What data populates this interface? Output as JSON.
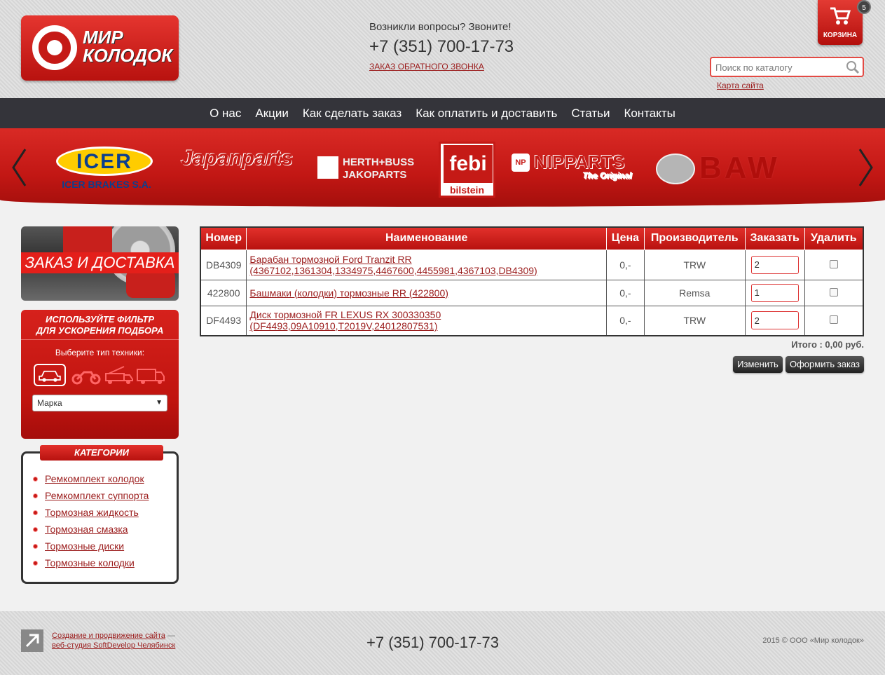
{
  "header": {
    "logo_text_line1": "МИР",
    "logo_text_line2": "КОЛОДОК",
    "questions": "Возникли вопросы? Звоните!",
    "phone": "+7 (351) 700-17-73",
    "callback": "ЗАКАЗ ОБРАТНОГО ЗВОНКА",
    "cart_label": "КОРЗИНА",
    "cart_count": "5",
    "search_placeholder": "Поиск по каталогу",
    "sitemap": "Карта сайта"
  },
  "nav": {
    "items": [
      "О нас",
      "Акции",
      "Как сделать заказ",
      "Как оплатить и доставить",
      "Статьи",
      "Контакты"
    ]
  },
  "brands": {
    "icer": "ICER",
    "icer_sub": "ICER BRAKES S.A.",
    "japanparts": "Japanparts",
    "herth_line1": "HERTH+BUSS",
    "herth_line2": "JAKOPARTS",
    "febi": "febi",
    "febi_sub": "bilstein",
    "nipparts_np": "NP",
    "nipparts": "NIPPARTS",
    "nipparts_sub": "The Original",
    "baw": "BAW"
  },
  "sidebar": {
    "order_banner": "ЗАКАЗ И ДОСТАВКА",
    "filter_title_line1": "ИСПОЛЬЗУЙТЕ ФИЛЬТР",
    "filter_title_line2": "ДЛЯ УСКОРЕНИЯ ПОДБОРА",
    "filter_sub": "Выберите тип техники:",
    "brand_select_value": "Марка",
    "categories_title": "КАТЕГОРИИ",
    "categories": [
      "Ремкомплект колодок",
      "Ремкомплект суппорта",
      "Тормозная жидкость",
      "Тормозная смазка",
      "Тормозные диски",
      "Тормозные колодки"
    ]
  },
  "order": {
    "columns": [
      "Номер",
      "Наименование",
      "Цена",
      "Производитель",
      "Заказать",
      "Удалить"
    ],
    "rows": [
      {
        "number": "DB4309",
        "name_line1": "Барабан тормозной Ford Tranzit RR",
        "name_line2": "(4367102,1361304,1334975,4467600,4455981,4367103,DB4309)",
        "price": "0,-",
        "maker": "TRW",
        "qty": "2"
      },
      {
        "number": "422800",
        "name_line1": "Башмаки (колодки) тормозные RR (422800)",
        "name_line2": "",
        "price": "0,-",
        "maker": "Remsa",
        "qty": "1"
      },
      {
        "number": "DF4493",
        "name_line1": "Диск тормозной FR LEXUS RX 300330350",
        "name_line2": "(DF4493,09A10910,T2019V,24012807531)",
        "price": "0,-",
        "maker": "TRW",
        "qty": "2"
      }
    ],
    "total": "Итого : 0,00 руб.",
    "change_button": "Изменить",
    "checkout_button": "Оформить заказ"
  },
  "footer": {
    "dev_link": "Создание и продвижение сайта",
    "dev_dash": " —",
    "dev_studio": "веб-студия SoftDevelop Челябинск",
    "phone": "+7 (351) 700-17-73",
    "copyright": "2015 © ООО «Мир колодок»"
  },
  "colors": {
    "brand_red": "#c51a16",
    "nav_bg": "#34343a",
    "link_red": "#9b1c1c"
  }
}
